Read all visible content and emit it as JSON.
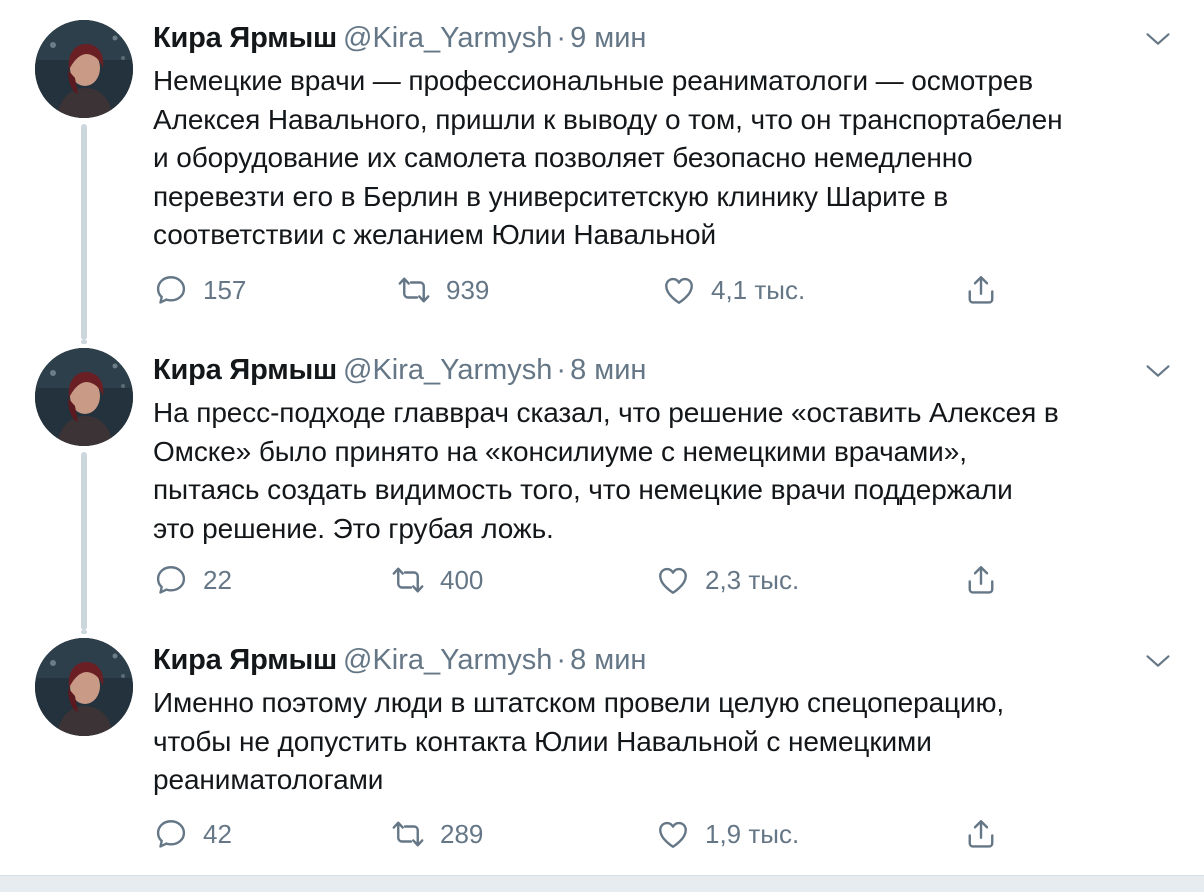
{
  "tweets": [
    {
      "name": "Кира Ярмыш",
      "handle": "@Kira_Yarmysh",
      "separator": "·",
      "time": "9 мин",
      "lines": [
        "Немецкие врачи — профессиональные реаниматологи — осмотрев",
        "Алексея Навального, пришли к выводу о том, что он транспортабелен",
        "и оборудование их самолета позволяет безопасно немедленно",
        "перевезти его в Берлин в университетскую клинику Шарите в",
        "соответствии с желанием Юлии Навальной"
      ],
      "replies": "157",
      "retweets": "939",
      "likes": "4,1 тыс."
    },
    {
      "name": "Кира Ярмыш",
      "handle": "@Kira_Yarmysh",
      "separator": "·",
      "time": "8 мин",
      "lines": [
        "На пресс-подходе главврач сказал, что решение «оставить Алексея в",
        "Омске» было принято на «консилиуме с немецкими врачами»,",
        "пытаясь создать видимость того, что немецкие врачи поддержали",
        "это решение. Это грубая ложь."
      ],
      "replies": "22",
      "retweets": "400",
      "likes": "2,3 тыс."
    },
    {
      "name": "Кира Ярмыш",
      "handle": "@Kira_Yarmysh",
      "separator": "·",
      "time": "8 мин",
      "lines": [
        "Именно поэтому люди в штатском провели целую спецоперацию,",
        "чтобы не допустить контакта Юлии Навальной с немецкими",
        "реаниматологами"
      ],
      "replies": "42",
      "retweets": "289",
      "likes": "1,9 тыс."
    }
  ],
  "icons": {
    "reply": "speech-bubble-icon",
    "retweet": "retweet-arrows-icon",
    "like": "heart-icon",
    "share": "share-upload-icon",
    "more": "chevron-down-icon"
  },
  "colors": {
    "text": "#14171a",
    "secondary": "#657786",
    "thread_line": "#ccd6dd",
    "divider": "#e6ecf0"
  }
}
